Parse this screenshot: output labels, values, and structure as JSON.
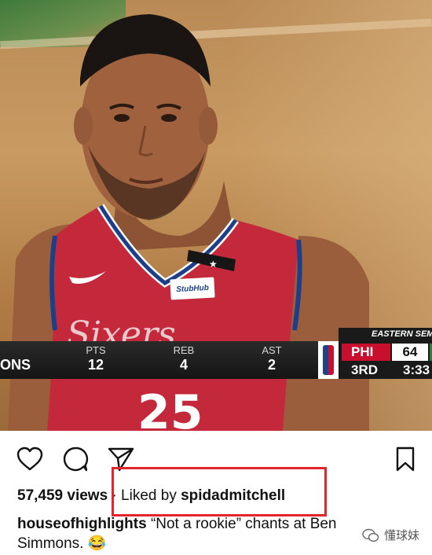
{
  "stats_bar": {
    "player_name": "ONS",
    "items": [
      {
        "label": "PTS",
        "value": "12"
      },
      {
        "label": "REB",
        "value": "4"
      },
      {
        "label": "AST",
        "value": "2"
      }
    ]
  },
  "scoreboard": {
    "conference": "EASTERN SEMI",
    "team": "PHI",
    "team_score": "64",
    "period": "3RD",
    "clock": "3:33"
  },
  "jersey": {
    "sponsor": "StubHub"
  },
  "post": {
    "views": "57,459 views",
    "separator": "·",
    "liked_by_prefix": "Liked by",
    "liked_by_user": "spidadmitchell",
    "caption_user": "houseofhighlights",
    "caption_text": "“Not a rookie” chants at Ben Simmons. 😂"
  },
  "watermark": {
    "text": "懂球妹"
  },
  "colors": {
    "highlight_box": "#e2242b",
    "sixers_red": "#c8102e",
    "sixers_blue": "#1d428a"
  },
  "icons": [
    "heart-icon",
    "comment-icon",
    "share-icon",
    "bookmark-icon",
    "nba-logo-icon",
    "wechat-icon"
  ]
}
